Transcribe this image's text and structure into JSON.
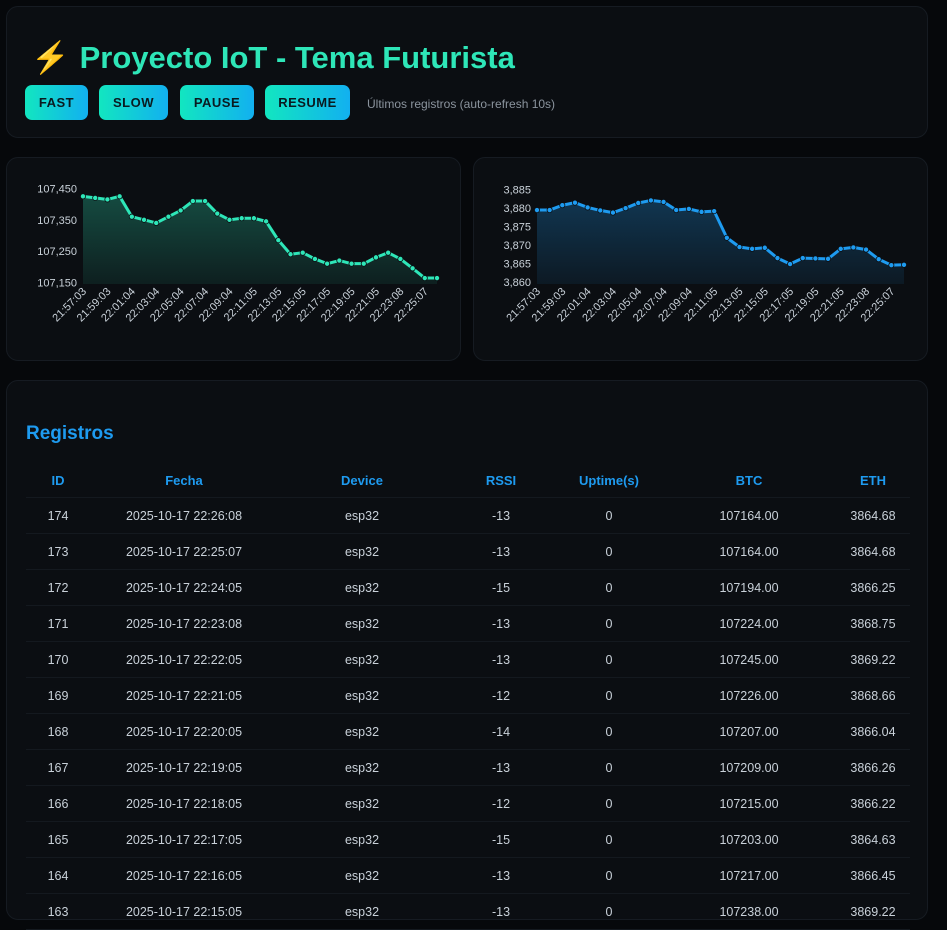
{
  "header": {
    "bolt": "⚡",
    "title": "Proyecto IoT - Tema Futurista",
    "buttons": {
      "fast": "FAST",
      "slow": "SLOW",
      "pause": "PAUSE",
      "resume": "RESUME"
    },
    "status": "Últimos registros (auto-refresh 10s)"
  },
  "colors": {
    "accent_green": "#2ee6b8",
    "accent_blue": "#1e9bf0",
    "bolt": "#f5c518"
  },
  "chart_data": [
    {
      "type": "area",
      "series": [
        {
          "values": [
            107425,
            107420,
            107415,
            107425,
            107360,
            107350,
            107340,
            107360,
            107380,
            107410,
            107410,
            107370,
            107350,
            107355,
            107355,
            107345,
            107285,
            107240,
            107245,
            107225,
            107210,
            107220,
            107210,
            107210,
            107230,
            107245,
            107225,
            107195,
            107164,
            107164
          ]
        }
      ],
      "x_labels": [
        "21:57:03",
        "21:59:03",
        "22:01:04",
        "22:03:04",
        "22:05:04",
        "22:07:04",
        "22:09:04",
        "22:11:05",
        "22:13:05",
        "22:15:05",
        "22:17:05",
        "22:19:05",
        "22:21:05",
        "22:23:08",
        "22:25:07"
      ],
      "y_ticks": [
        107150,
        107250,
        107350,
        107450
      ],
      "y_tick_labels": [
        "107,150",
        "107,250",
        "107,350",
        "107,450"
      ],
      "ylim": [
        107145,
        107458
      ],
      "color": "#2ee6b8"
    },
    {
      "type": "area",
      "series": [
        {
          "values": [
            3879.5,
            3879.5,
            3880.8,
            3881.5,
            3880.2,
            3879.4,
            3878.8,
            3880.0,
            3881.4,
            3882.1,
            3881.7,
            3879.5,
            3879.8,
            3879.0,
            3879.2,
            3872.0,
            3869.5,
            3869.0,
            3869.3,
            3866.5,
            3864.9,
            3866.5,
            3866.4,
            3866.3,
            3869.0,
            3869.4,
            3868.8,
            3866.2,
            3864.6,
            3864.7
          ]
        }
      ],
      "x_labels": [
        "21:57:03",
        "21:59:03",
        "22:01:04",
        "22:03:04",
        "22:05:04",
        "22:07:04",
        "22:09:04",
        "22:11:05",
        "22:13:05",
        "22:15:05",
        "22:17:05",
        "22:19:05",
        "22:21:05",
        "22:23:08",
        "22:25:07"
      ],
      "y_ticks": [
        3860,
        3865,
        3870,
        3875,
        3880,
        3885
      ],
      "y_tick_labels": [
        "3,860",
        "3,865",
        "3,870",
        "3,875",
        "3,880",
        "3,885"
      ],
      "ylim": [
        3859.5,
        3886
      ],
      "color": "#1e9bf0"
    }
  ],
  "table": {
    "title": "Registros",
    "columns": [
      "ID",
      "Fecha",
      "Device",
      "RSSI",
      "Uptime(s)",
      "BTC",
      "ETH"
    ],
    "rows": [
      [
        "174",
        "2025-10-17 22:26:08",
        "esp32",
        "-13",
        "0",
        "107164.00",
        "3864.68"
      ],
      [
        "173",
        "2025-10-17 22:25:07",
        "esp32",
        "-13",
        "0",
        "107164.00",
        "3864.68"
      ],
      [
        "172",
        "2025-10-17 22:24:05",
        "esp32",
        "-15",
        "0",
        "107194.00",
        "3866.25"
      ],
      [
        "171",
        "2025-10-17 22:23:08",
        "esp32",
        "-13",
        "0",
        "107224.00",
        "3868.75"
      ],
      [
        "170",
        "2025-10-17 22:22:05",
        "esp32",
        "-13",
        "0",
        "107245.00",
        "3869.22"
      ],
      [
        "169",
        "2025-10-17 22:21:05",
        "esp32",
        "-12",
        "0",
        "107226.00",
        "3868.66"
      ],
      [
        "168",
        "2025-10-17 22:20:05",
        "esp32",
        "-14",
        "0",
        "107207.00",
        "3866.04"
      ],
      [
        "167",
        "2025-10-17 22:19:05",
        "esp32",
        "-13",
        "0",
        "107209.00",
        "3866.26"
      ],
      [
        "166",
        "2025-10-17 22:18:05",
        "esp32",
        "-12",
        "0",
        "107215.00",
        "3866.22"
      ],
      [
        "165",
        "2025-10-17 22:17:05",
        "esp32",
        "-15",
        "0",
        "107203.00",
        "3864.63"
      ],
      [
        "164",
        "2025-10-17 22:16:05",
        "esp32",
        "-13",
        "0",
        "107217.00",
        "3866.45"
      ],
      [
        "163",
        "2025-10-17 22:15:05",
        "esp32",
        "-13",
        "0",
        "107238.00",
        "3869.22"
      ]
    ]
  }
}
